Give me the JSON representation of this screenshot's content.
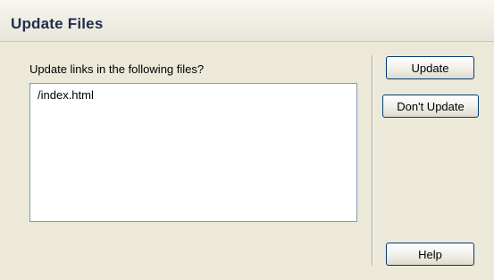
{
  "window": {
    "title": "Update Files"
  },
  "prompt": "Update links in the following files?",
  "files": [
    "/index.html"
  ],
  "buttons": {
    "update": "Update",
    "dont_update": "Don't Update",
    "help": "Help"
  }
}
